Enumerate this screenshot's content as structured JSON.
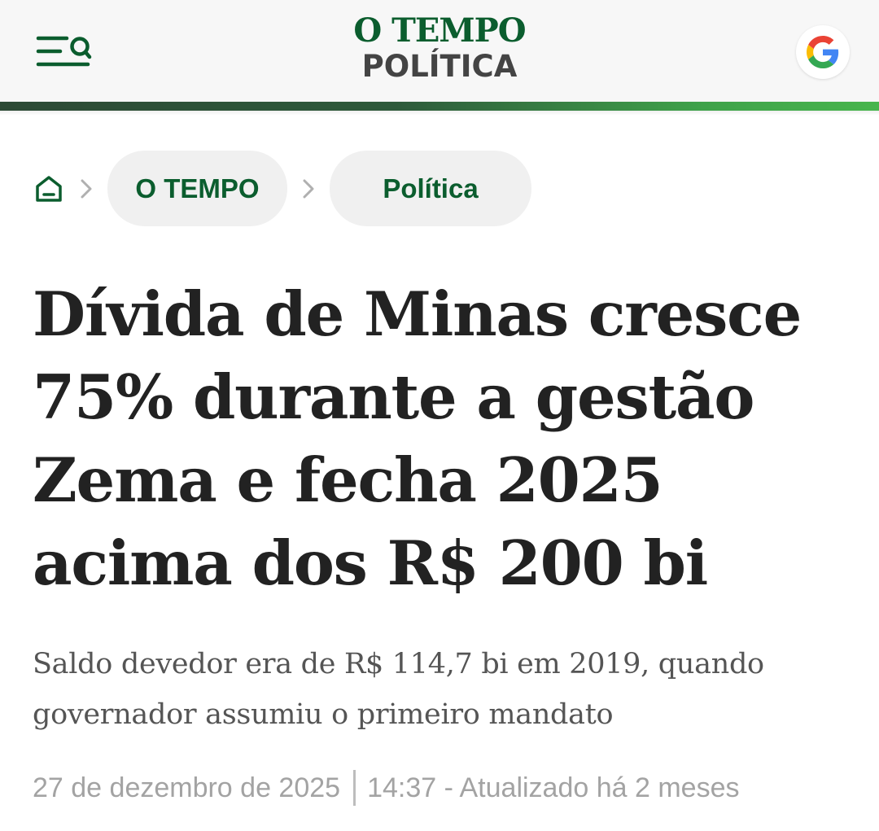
{
  "header": {
    "brand_name": "O TEMPO",
    "section": "POLÍTICA",
    "menu_icon": "menu-search-icon",
    "google_icon": "google-icon",
    "colors": {
      "brand_green": "#0b5d2e",
      "accent_bar_start": "#2d4a35",
      "accent_bar_end": "#48b54d"
    }
  },
  "breadcrumb": {
    "home_icon": "home-icon",
    "separator_icon": "chevron-right-icon",
    "items": [
      {
        "label": "O TEMPO"
      },
      {
        "label": "Política"
      }
    ]
  },
  "article": {
    "headline": "Dívida de Minas cresce 75% durante a gestão Zema e fecha 2025 acima dos R$ 200 bi",
    "subtitle": "Saldo devedor era de R$ 114,7 bi em 2019, quando governador assumiu o primeiro mandato",
    "date": "27 de dezembro de 2025",
    "time_updated": "14:37 - Atualizado há 2 meses"
  }
}
